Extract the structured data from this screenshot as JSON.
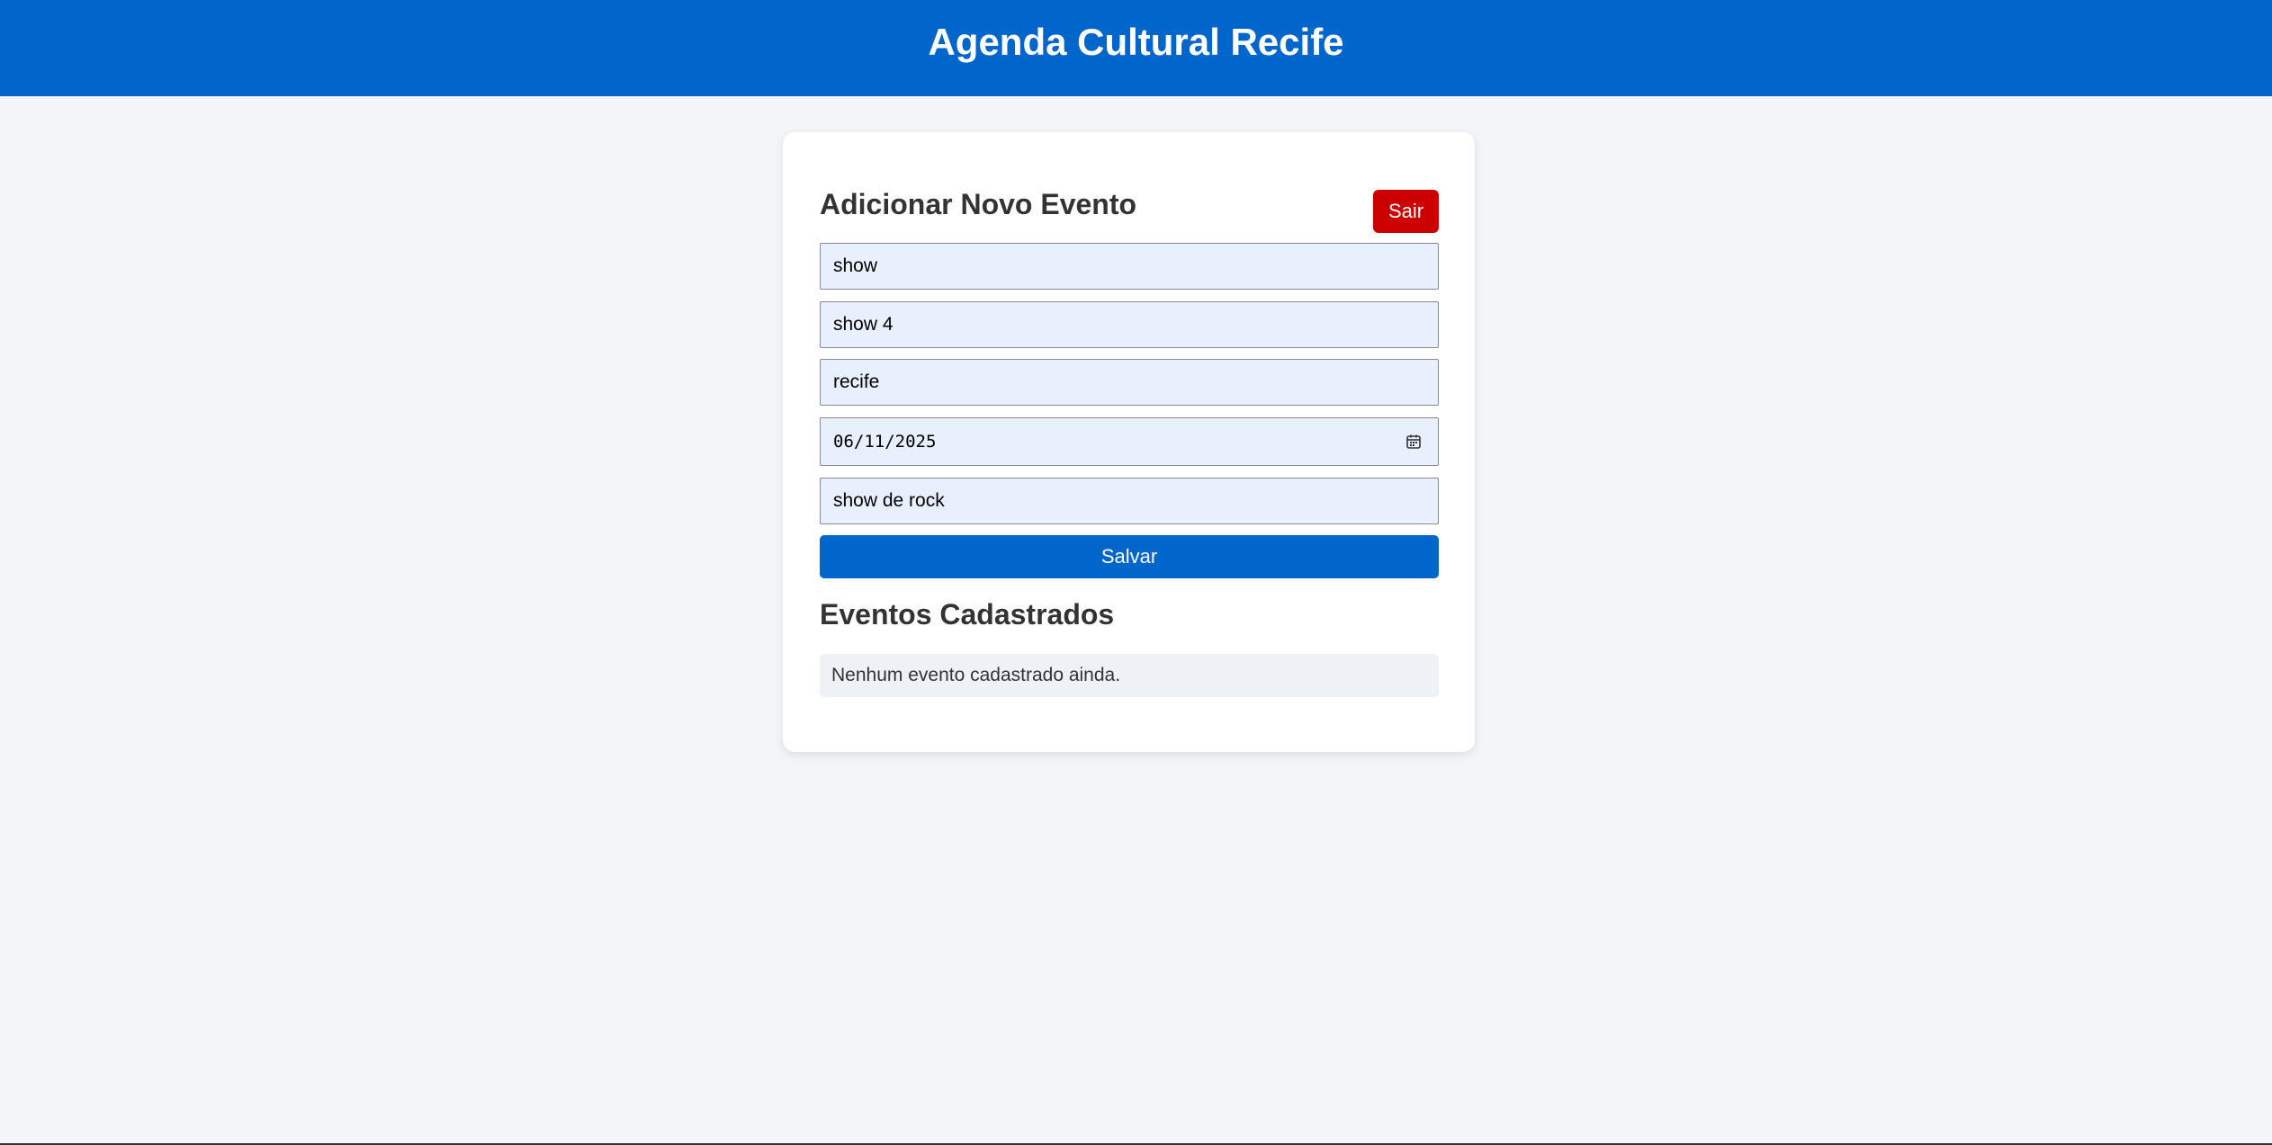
{
  "header": {
    "title": "Agenda Cultural Recife"
  },
  "form": {
    "title": "Adicionar Novo Evento",
    "logout_label": "Sair",
    "fields": {
      "field_1_value": "show",
      "field_2_value": "show 4",
      "field_3_value": "recife",
      "date_value": "06/11/2025",
      "field_5_value": "show de rock"
    },
    "save_label": "Salvar"
  },
  "events": {
    "title": "Eventos Cadastrados",
    "empty_message": "Nenhum evento cadastrado ainda."
  },
  "icons": {
    "date_field": "calendar-icon"
  },
  "colors": {
    "primary": "#0166cc",
    "danger": "#cc0000",
    "background": "#f3f5f8",
    "input_fill": "#e8f0fe"
  }
}
